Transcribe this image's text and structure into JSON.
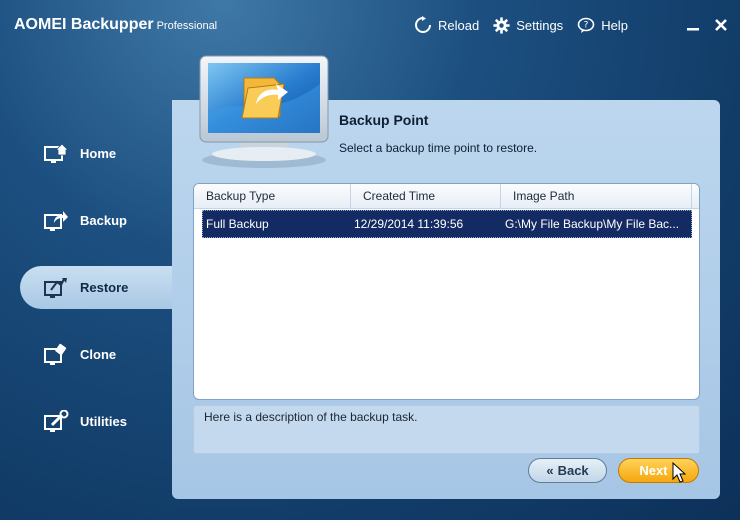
{
  "app": {
    "name": "AOMEI Backupper",
    "edition": "Professional"
  },
  "topnav": {
    "reload": "Reload",
    "settings": "Settings",
    "help": "Help"
  },
  "sidebar": {
    "items": [
      {
        "label": "Home",
        "icon": "home-icon"
      },
      {
        "label": "Backup",
        "icon": "backup-icon"
      },
      {
        "label": "Restore",
        "icon": "restore-icon",
        "active": true
      },
      {
        "label": "Clone",
        "icon": "clone-icon"
      },
      {
        "label": "Utilities",
        "icon": "utilities-icon"
      }
    ]
  },
  "main": {
    "title": "Backup Point",
    "subtitle": "Select a backup time point to restore.",
    "table": {
      "columns": [
        "Backup Type",
        "Created Time",
        "Image Path"
      ],
      "rows": [
        {
          "type": "Full Backup",
          "created": "12/29/2014 11:39:56",
          "path": "G:\\My File Backup\\My File Bac..."
        }
      ]
    },
    "description": "Here is a description of the backup task."
  },
  "buttons": {
    "back": "Back",
    "back_glyph": "«",
    "next": "Next"
  },
  "colors": {
    "accent_orange": "#f5a70d",
    "selection_navy": "#142a63",
    "panel_blue": "#bcd6ee"
  }
}
